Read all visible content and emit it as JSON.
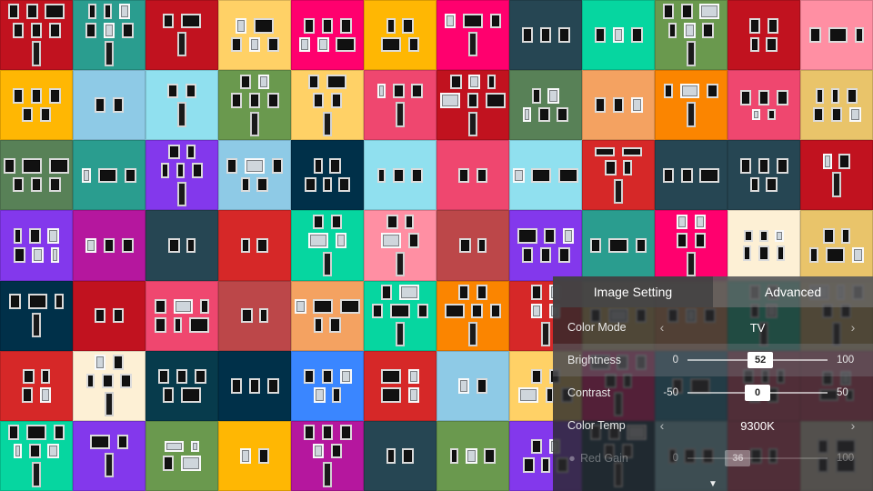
{
  "osd": {
    "tabs": {
      "image_setting": "Image Setting",
      "advanced": "Advanced",
      "active": "image_setting"
    },
    "color_mode": {
      "label": "Color Mode",
      "value": "TV"
    },
    "brightness": {
      "label": "Brightness",
      "min": "0",
      "max": "100",
      "value": "52",
      "pct": 52
    },
    "contrast": {
      "label": "Contrast",
      "min": "-50",
      "max": "50",
      "value": "0",
      "pct": 50
    },
    "color_temp": {
      "label": "Color Temp",
      "value": "9300K"
    },
    "red_gain": {
      "label": "Red Gain",
      "min": "0",
      "max": "100",
      "value": "36",
      "pct": 36,
      "bullet": "●"
    },
    "scroll_hint": "▼"
  },
  "mosaic_palette": [
    "#e63946",
    "#f4a261",
    "#e9c46a",
    "#2a9d8f",
    "#264653",
    "#8ecae6",
    "#219ebc",
    "#ffb703",
    "#fb8500",
    "#d62828",
    "#6a994e",
    "#bc4749",
    "#8338ec",
    "#3a86ff",
    "#ff006e",
    "#06d6a0",
    "#ef476f",
    "#ffd166",
    "#118ab2",
    "#073b4c",
    "#b5179e",
    "#ff8fa3",
    "#90e0ef",
    "#c1121f",
    "#fdf0d5",
    "#003049",
    "#588157"
  ]
}
